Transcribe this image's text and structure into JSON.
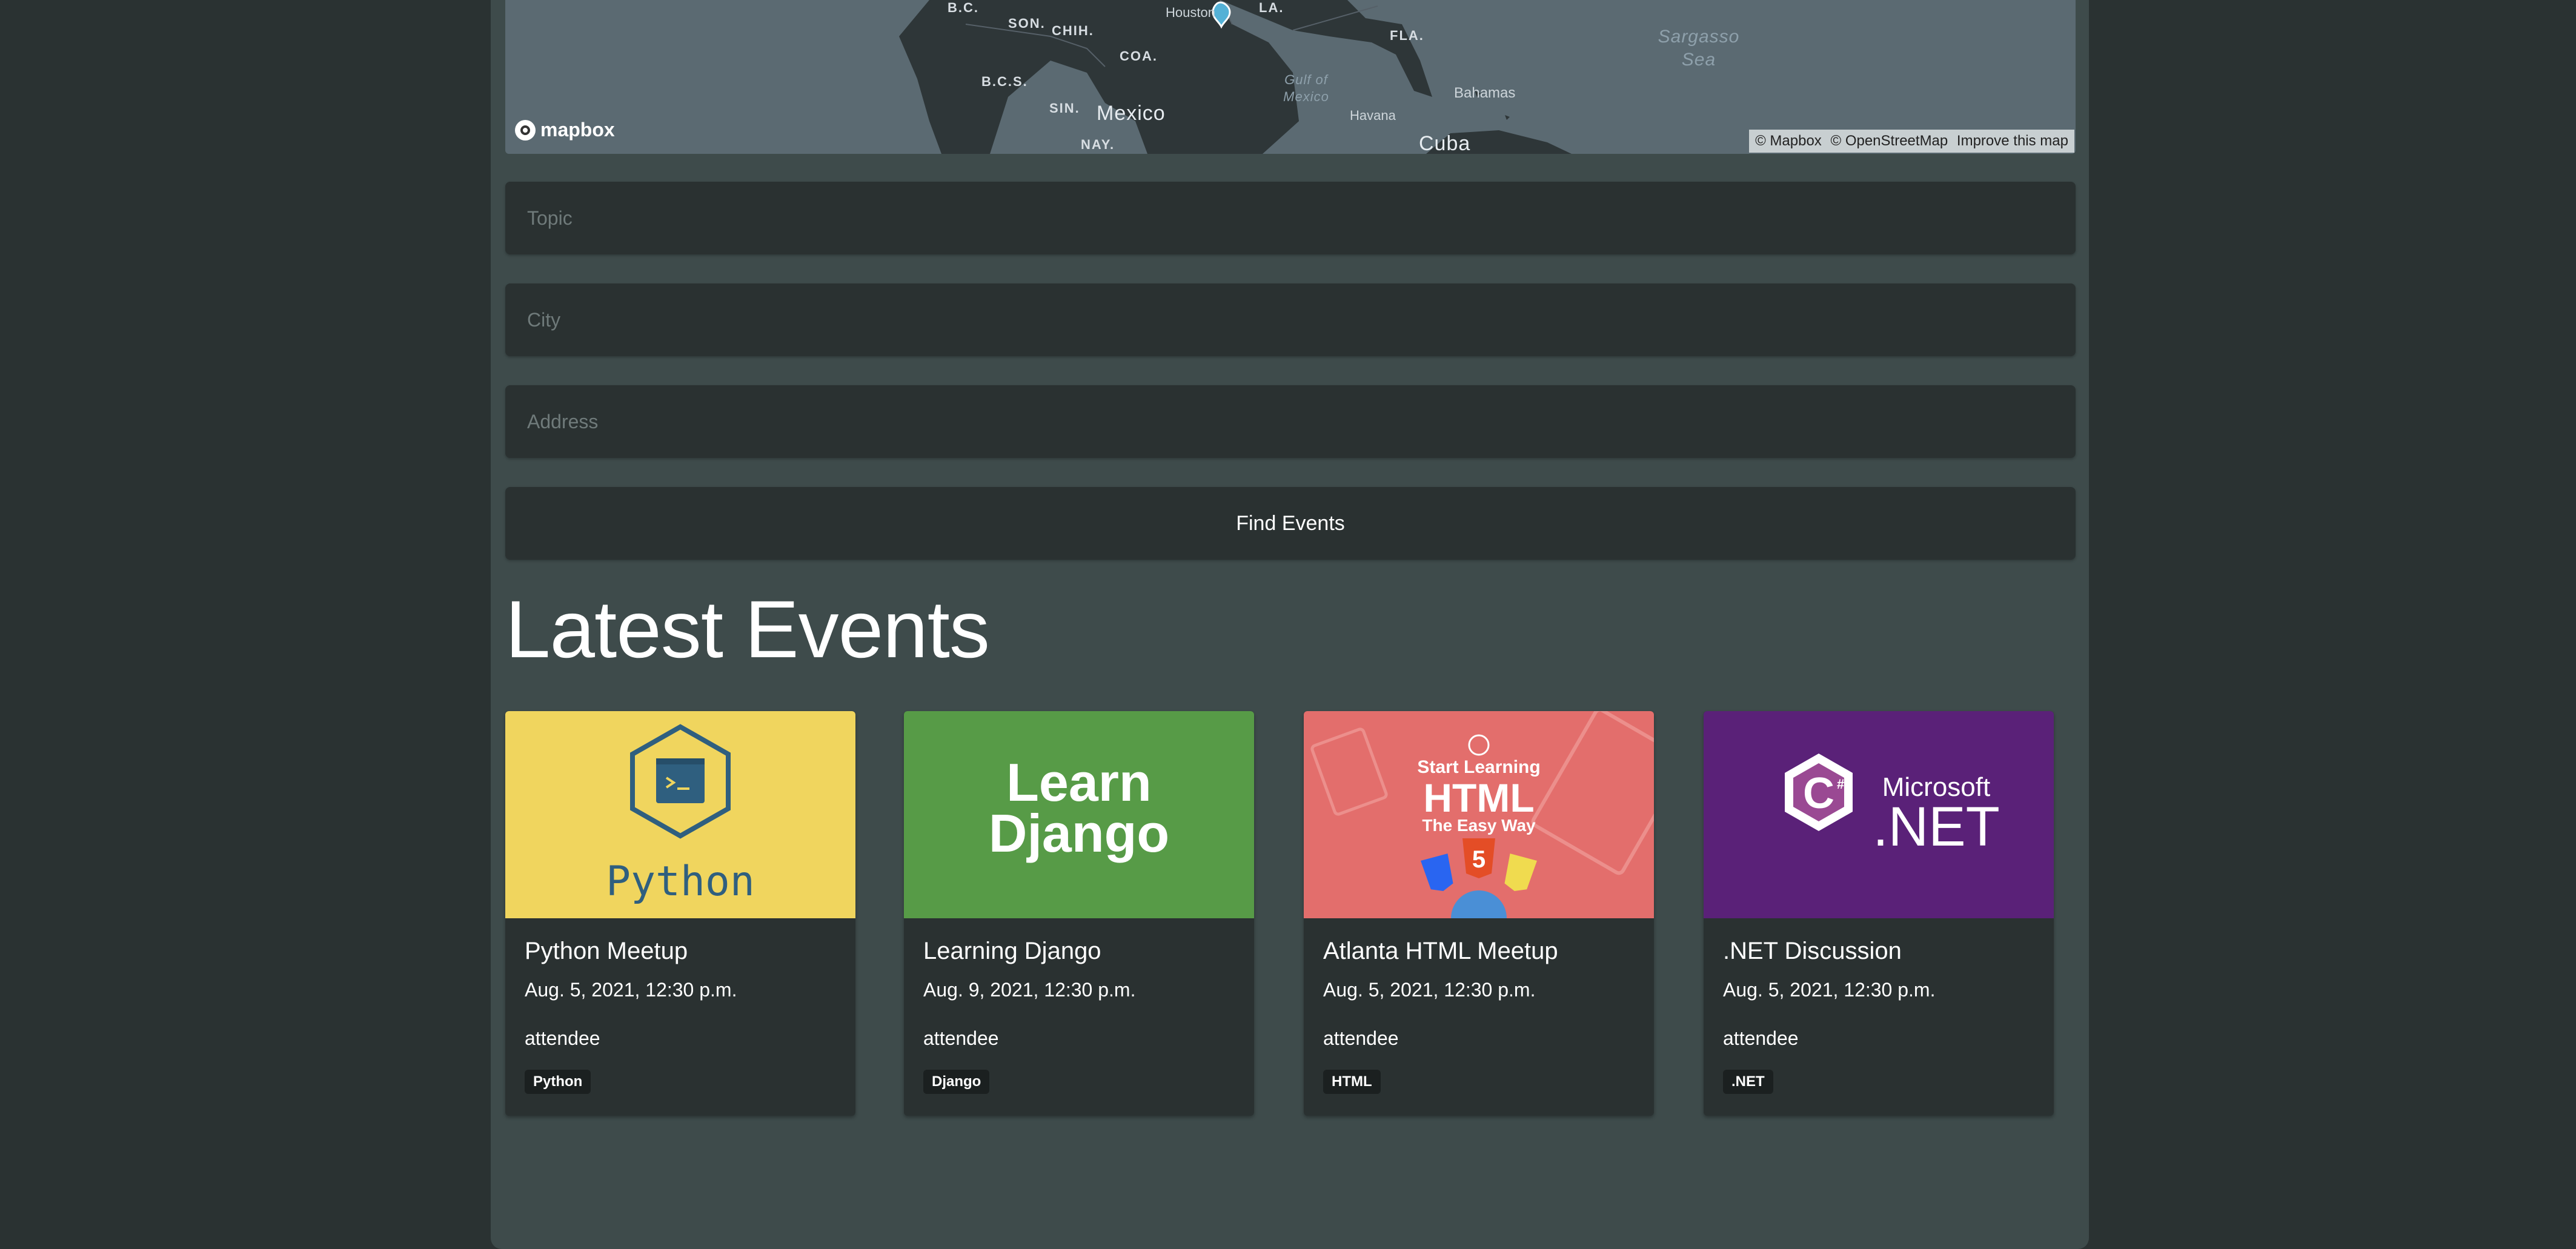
{
  "map": {
    "labels": {
      "bc": "B.C.",
      "son": "SON.",
      "chih": "CHIH.",
      "houston": "Houston",
      "la": "LA.",
      "fla": "FLA.",
      "coa": "COA.",
      "bcs": "B.C.S.",
      "sin": "SIN.",
      "mexico": "Mexico",
      "nay": "NAY.",
      "gulf": "Gulf of Mexico",
      "havana": "Havana",
      "bahamas": "Bahamas",
      "cuba": "Cuba",
      "sargasso": "Sargasso Sea"
    },
    "logo_text": "mapbox",
    "attribution": {
      "mapbox": "© Mapbox",
      "osm": "© OpenStreetMap",
      "improve": "Improve this map"
    }
  },
  "search": {
    "topic_placeholder": "Topic",
    "city_placeholder": "City",
    "address_placeholder": "Address",
    "find_label": "Find Events"
  },
  "section_title": "Latest Events",
  "events": [
    {
      "title": "Python Meetup",
      "date": "Aug. 5, 2021, 12:30 p.m.",
      "role": "attendee",
      "tag": "Python",
      "thumb_text": "Python",
      "thumb_color": "#f0d55e"
    },
    {
      "title": "Learning Django",
      "date": "Aug. 9, 2021, 12:30 p.m.",
      "role": "attendee",
      "tag": "Django",
      "thumb_text_1": "Learn",
      "thumb_text_2": "Django",
      "thumb_color": "#579b47"
    },
    {
      "title": "Atlanta HTML Meetup",
      "date": "Aug. 5, 2021, 12:30 p.m.",
      "role": "attendee",
      "tag": "HTML",
      "thumb_text_1": "Start Learning",
      "thumb_text_2": "HTML",
      "thumb_text_3": "The Easy Way",
      "thumb_color": "#e36e6c"
    },
    {
      "title": ".NET Discussion",
      "date": "Aug. 5, 2021, 12:30 p.m.",
      "role": "attendee",
      "tag": ".NET",
      "thumb_text_1": "Microsoft",
      "thumb_text_2": ".NET",
      "thumb_color": "#5a2178"
    }
  ]
}
